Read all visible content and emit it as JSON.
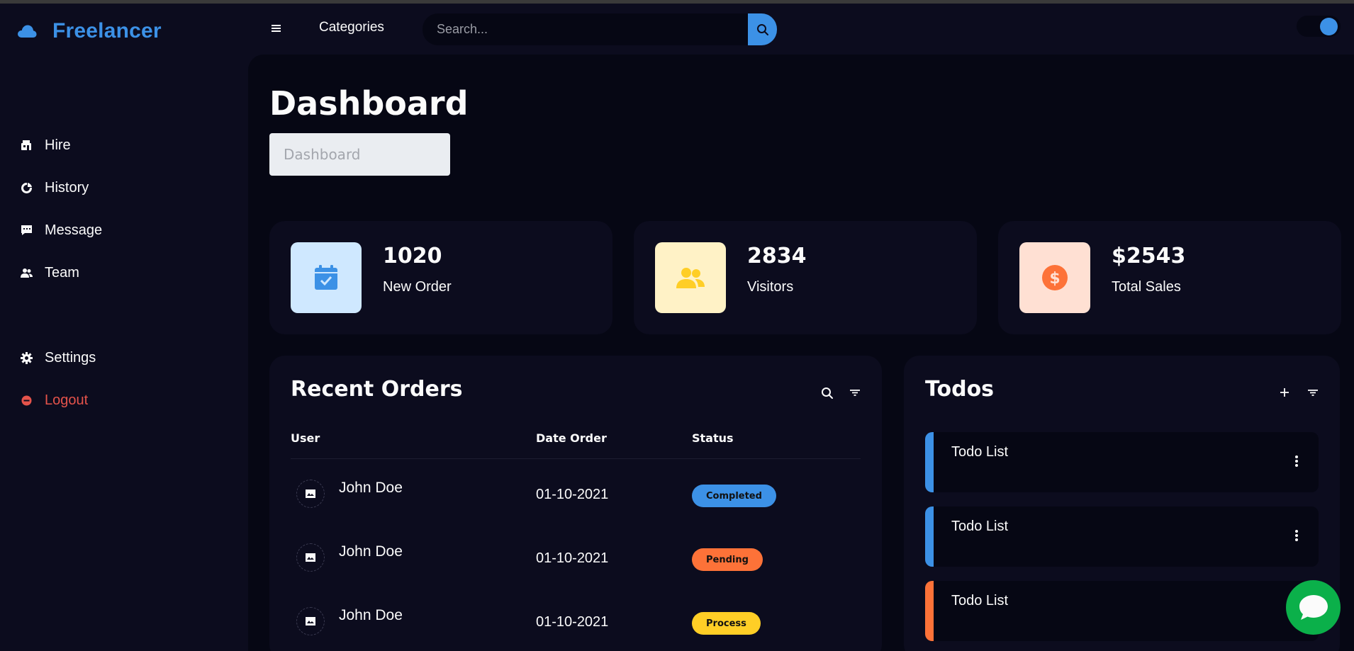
{
  "brand": {
    "name": "Freelancer"
  },
  "sidebar": {
    "top_items": [
      {
        "label": "Hire",
        "icon": "store-icon"
      },
      {
        "label": "History",
        "icon": "pie-chart-icon"
      },
      {
        "label": "Message",
        "icon": "message-icon"
      },
      {
        "label": "Team",
        "icon": "group-icon"
      }
    ],
    "bottom_items": [
      {
        "label": "Settings",
        "icon": "gear-icon"
      },
      {
        "label": "Logout",
        "icon": "logout-icon"
      }
    ]
  },
  "nav": {
    "categories_label": "Categories",
    "search_placeholder": "Search..."
  },
  "page": {
    "title": "Dashboard",
    "breadcrumb": "Dashboard"
  },
  "stats": [
    {
      "value": "1020",
      "label": "New Order",
      "icon": "calendar-check-icon",
      "bg": "#cfe8ff",
      "fg": "#3c91e6"
    },
    {
      "value": "2834",
      "label": "Visitors",
      "icon": "group-icon",
      "bg": "#fff2c6",
      "fg": "#ffce26"
    },
    {
      "value": "$2543",
      "label": "Total Sales",
      "icon": "dollar-circle-icon",
      "bg": "#ffe0d3",
      "fg": "#fd7238"
    }
  ],
  "orders": {
    "title": "Recent Orders",
    "columns": [
      "User",
      "Date Order",
      "Status"
    ],
    "rows": [
      {
        "user": "John Doe",
        "date": "01-10-2021",
        "status": "Completed",
        "color": "#3c91e6"
      },
      {
        "user": "John Doe",
        "date": "01-10-2021",
        "status": "Pending",
        "color": "#fd7238"
      },
      {
        "user": "John Doe",
        "date": "01-10-2021",
        "status": "Process",
        "color": "#ffce26"
      }
    ]
  },
  "todos": {
    "title": "Todos",
    "items": [
      {
        "label": "Todo List",
        "color": "#3c91e6"
      },
      {
        "label": "Todo List",
        "color": "#3c91e6"
      },
      {
        "label": "Todo List",
        "color": "#fd7238"
      }
    ]
  },
  "colors": {
    "accent": "#3c91e6",
    "chat": "#0bb04a",
    "logout": "#e5534b"
  }
}
